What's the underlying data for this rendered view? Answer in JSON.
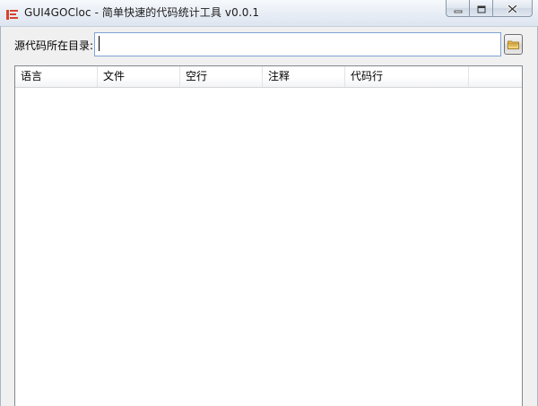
{
  "window": {
    "title": "GUI4GOCloc - 简单快速的代码统计工具 v0.0.1"
  },
  "icons": {
    "app": "app-logo-icon",
    "minimize": "minimize-icon",
    "maximize": "maximize-icon",
    "close": "close-icon",
    "browse": "folder-icon"
  },
  "directory": {
    "label": "源代码所在目录:",
    "value": "",
    "placeholder": ""
  },
  "table": {
    "columns": [
      "语言",
      "文件",
      "空行",
      "注释",
      "代码行"
    ],
    "rows": []
  },
  "colors": {
    "accent_icon": "#d9412b",
    "input_border": "#7ea3d3",
    "folder": "#e8b84a"
  }
}
